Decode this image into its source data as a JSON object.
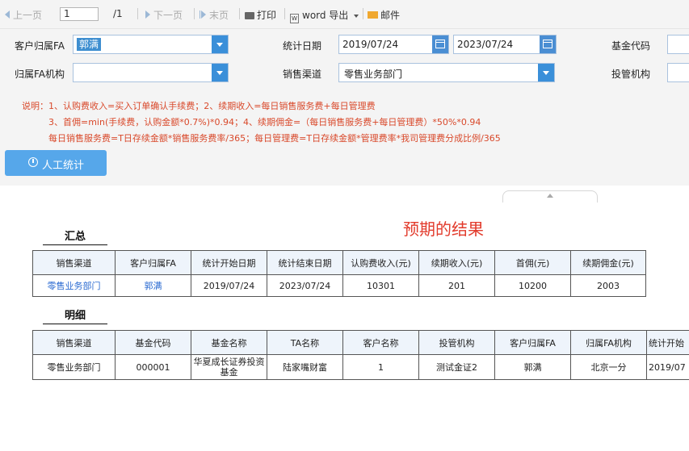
{
  "toolbar": {
    "prev": "上一页",
    "page_value": "1",
    "page_total": "/1",
    "next": "下一页",
    "last": "末页",
    "print": "打印",
    "word_export": "word 导出",
    "mail": "邮件"
  },
  "form": {
    "customer_fa_label": "客户归属FA",
    "customer_fa_value": "郭满",
    "fa_org_label": "归属FA机构",
    "fa_org_value": "",
    "stat_date_label": "统计日期",
    "stat_date_start": "2019/07/24",
    "stat_date_end": "2023/07/24",
    "sales_channel_label": "销售渠道",
    "sales_channel_value": "零售业务部门",
    "fund_code_label": "基金代码",
    "custody_label": "投管机构"
  },
  "notes": [
    "说明：1、认购费收入=买入订单确认手续费；2、续期收入=每日销售服务费+每日管理费",
    "3、首佣=min(手续费，认购金额*0.7%)*0.94；4、续期佣金=（每日销售服务费+每日管理费）*50%*0.94",
    "每日销售服务费=T日存续金额*销售服务费率/365；每日管理费=T日存续金额*管理费率*我司管理费分成比例/365"
  ],
  "manual_button": "人工统计",
  "expected_result": "预期的结果",
  "summary": {
    "title": "汇总",
    "headers": [
      "销售渠道",
      "客户归属FA",
      "统计开始日期",
      "统计结束日期",
      "认购费收入(元)",
      "续期收入(元)",
      "首佣(元)",
      "续期佣金(元)"
    ],
    "row": [
      "零售业务部门",
      "郭满",
      "2019/07/24",
      "2023/07/24",
      "10301",
      "201",
      "10200",
      "2003"
    ]
  },
  "detail": {
    "title": "明细",
    "headers": [
      "销售渠道",
      "基金代码",
      "基金名称",
      "TA名称",
      "客户名称",
      "投管机构",
      "客户归属FA",
      "归属FA机构",
      "统计开始"
    ],
    "row": [
      "零售业务部门",
      "000001",
      "华夏成长证券投资基金",
      "陆家嘴财富",
      "1",
      "测试金证2",
      "郭满",
      "北京一分",
      "2019/07"
    ]
  }
}
